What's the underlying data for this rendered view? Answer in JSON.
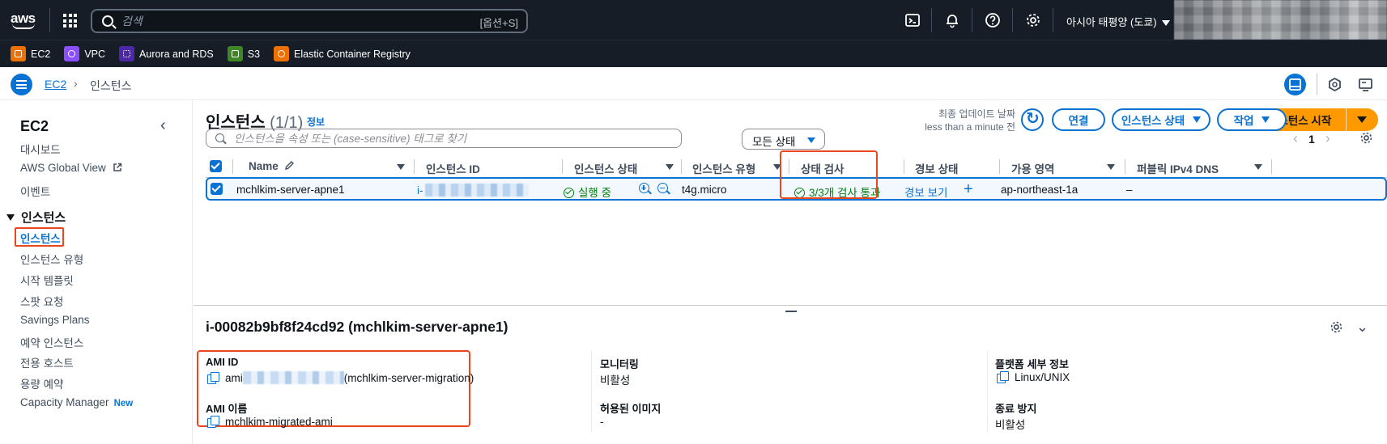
{
  "topnav": {
    "logo": "aws",
    "search_placeholder": "검색",
    "search_shortcut": "[옵션+S]",
    "region": "아시아 태평양 (도쿄)",
    "icons": [
      "cloudshell-icon",
      "bell-icon",
      "help-icon",
      "settings-icon"
    ]
  },
  "favorites": [
    {
      "label": "EC2",
      "color": "#ed7100"
    },
    {
      "label": "VPC",
      "color": "#8c4fff"
    },
    {
      "label": "Aurora and RDS",
      "color": "#4d27aa"
    },
    {
      "label": "S3",
      "color": "#3f8624"
    },
    {
      "label": "Elastic Container Registry",
      "color": "#ed7100"
    }
  ],
  "breadcrumb": {
    "root": "EC2",
    "separator": "›",
    "current": "인스턴스"
  },
  "sidebar": {
    "title": "EC2",
    "items_top": [
      "대시보드",
      "AWS Global View",
      "이벤트"
    ],
    "section_instances": "인스턴스",
    "items_instances": [
      "인스턴스",
      "인스턴스 유형",
      "시작 템플릿",
      "스팟 요청",
      "Savings Plans",
      "예약 인스턴스",
      "전용 호스트",
      "용량 예약",
      "Capacity Manager"
    ],
    "new_badge": "New"
  },
  "main": {
    "title": "인스턴스",
    "count": "(1/1)",
    "info": "정보",
    "last_updated_label": "최종 업데이트 날짜",
    "last_updated_value": "less than a minute 전",
    "connect_btn": "연결",
    "instance_state_btn": "인스턴스 상태",
    "actions_btn": "작업",
    "launch_btn": "인스턴스 시작",
    "filter_placeholder": "인스턴스을 속성 또는 (case-sensitive) 태그로 찾기",
    "state_filter": "모든 상태",
    "page": "1"
  },
  "table": {
    "columns": [
      "Name",
      "인스턴스 ID",
      "인스턴스 상태",
      "인스턴스 유형",
      "상태 검사",
      "경보 상태",
      "가용 영역",
      "퍼블릭 IPv4 DNS"
    ],
    "rows": [
      {
        "name": "mchlkim-server-apne1",
        "instance_id_prefix": "i-",
        "state": "실행 중",
        "type": "t4g.micro",
        "status_check": "3/3개 검사 통과",
        "alarm": "경보 보기",
        "az": "ap-northeast-1a",
        "public_dns": "–"
      }
    ]
  },
  "details": {
    "title": "i-00082b9bf8f24cd92 (mchlkim-server-apne1)",
    "ami_id_label": "AMI ID",
    "ami_id_prefix": "ami",
    "ami_id_suffix": "(mchlkim-server-migration)",
    "ami_name_label": "AMI 이름",
    "ami_name_value": "mchlkim-migrated-ami",
    "monitoring_label": "모니터링",
    "monitoring_value": "비활성",
    "allowed_image_label": "허용된 이미지",
    "allowed_image_value": "-",
    "platform_label": "플랫폼 세부 정보",
    "platform_value": "Linux/UNIX",
    "termination_label": "종료 방지",
    "termination_value": "비활성"
  }
}
